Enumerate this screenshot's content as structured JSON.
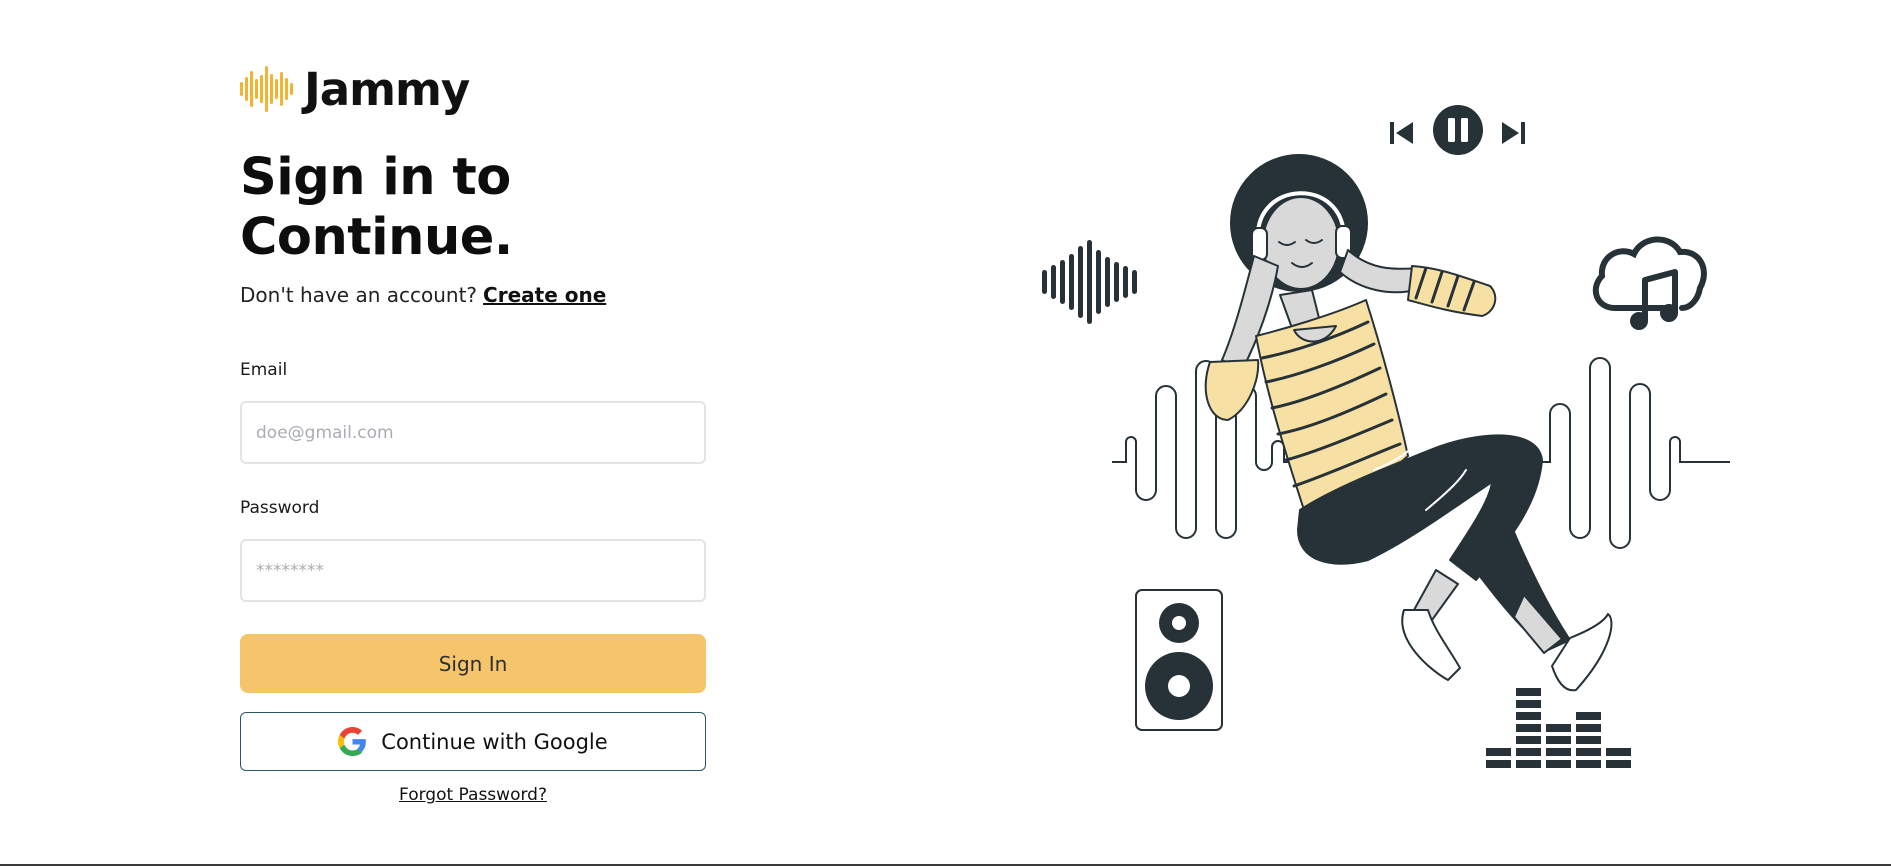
{
  "brand": {
    "name": "Jammy",
    "accent": "#f2b431"
  },
  "heading": {
    "line1": "Sign in to",
    "line2": "Continue."
  },
  "signup": {
    "prompt": "Don't have an account?",
    "link": "Create one"
  },
  "form": {
    "email_label": "Email",
    "email_placeholder": "doe@gmail.com",
    "password_label": "Password",
    "password_placeholder": "********",
    "signin_label": "Sign In",
    "google_label": "Continue with Google",
    "forgot_label": "Forgot Password?"
  },
  "colors": {
    "signin_bg": "#f4c56b",
    "ink": "#263238",
    "shirt": "#f7e0a3",
    "skin": "#d9d9d9"
  },
  "icons": [
    "logo-soundwave-icon",
    "google-icon",
    "previous-icon",
    "pause-icon",
    "next-icon",
    "soundwave-icon",
    "cloud-music-icon",
    "speaker-icon",
    "equalizer-icon"
  ]
}
